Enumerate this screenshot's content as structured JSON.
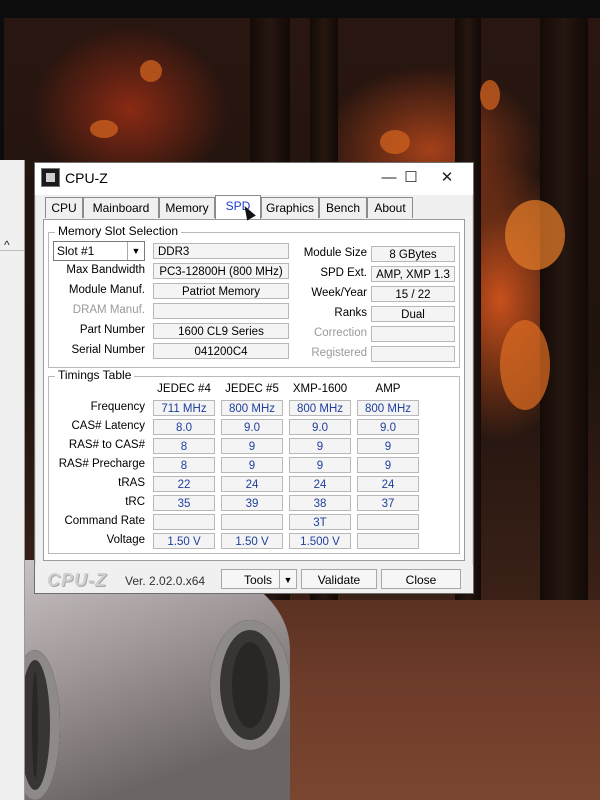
{
  "window": {
    "title": "CPU-Z",
    "minimize": "—",
    "maximize": "☐",
    "close": "✕"
  },
  "tabs": [
    {
      "label": "CPU"
    },
    {
      "label": "Mainboard"
    },
    {
      "label": "Memory"
    },
    {
      "label": "SPD",
      "active": true
    },
    {
      "label": "Graphics"
    },
    {
      "label": "Bench"
    },
    {
      "label": "About"
    }
  ],
  "slot": {
    "group_title": "Memory Slot Selection",
    "selected": "Slot #1",
    "type": "DDR3",
    "labels": {
      "max_bandwidth": "Max Bandwidth",
      "module_manuf": "Module Manuf.",
      "dram_manuf": "DRAM Manuf.",
      "part_number": "Part Number",
      "serial_number": "Serial Number",
      "module_size": "Module Size",
      "spd_ext": "SPD Ext.",
      "week_year": "Week/Year",
      "ranks": "Ranks",
      "correction": "Correction",
      "registered": "Registered"
    },
    "values": {
      "max_bandwidth": "PC3-12800H (800 MHz)",
      "module_manuf": "Patriot Memory",
      "dram_manuf": "",
      "part_number": "1600 CL9 Series",
      "serial_number": "041200C4",
      "module_size": "8 GBytes",
      "spd_ext": "AMP, XMP 1.3",
      "week_year": "15 / 22",
      "ranks": "Dual",
      "correction": "",
      "registered": ""
    }
  },
  "timings": {
    "group_title": "Timings Table",
    "columns": [
      "JEDEC #4",
      "JEDEC #5",
      "XMP-1600",
      "AMP"
    ],
    "rows": [
      {
        "label": "Frequency",
        "values": [
          "711 MHz",
          "800 MHz",
          "800 MHz",
          "800 MHz"
        ]
      },
      {
        "label": "CAS# Latency",
        "values": [
          "8.0",
          "9.0",
          "9.0",
          "9.0"
        ]
      },
      {
        "label": "RAS# to CAS#",
        "values": [
          "8",
          "9",
          "9",
          "9"
        ]
      },
      {
        "label": "RAS# Precharge",
        "values": [
          "8",
          "9",
          "9",
          "9"
        ]
      },
      {
        "label": "tRAS",
        "values": [
          "22",
          "24",
          "24",
          "24"
        ]
      },
      {
        "label": "tRC",
        "values": [
          "35",
          "39",
          "38",
          "37"
        ]
      },
      {
        "label": "Command Rate",
        "values": [
          "",
          "",
          "3T",
          ""
        ]
      },
      {
        "label": "Voltage",
        "values": [
          "1.50 V",
          "1.50 V",
          "1.500 V",
          ""
        ]
      }
    ]
  },
  "footer": {
    "brand": "CPU-Z",
    "version": "Ver. 2.02.0.x64",
    "tools": "Tools",
    "tools_arrow": "▼",
    "validate": "Validate",
    "close": "Close"
  },
  "icons": {
    "dropdown": "▼",
    "left_chevron": "^"
  }
}
